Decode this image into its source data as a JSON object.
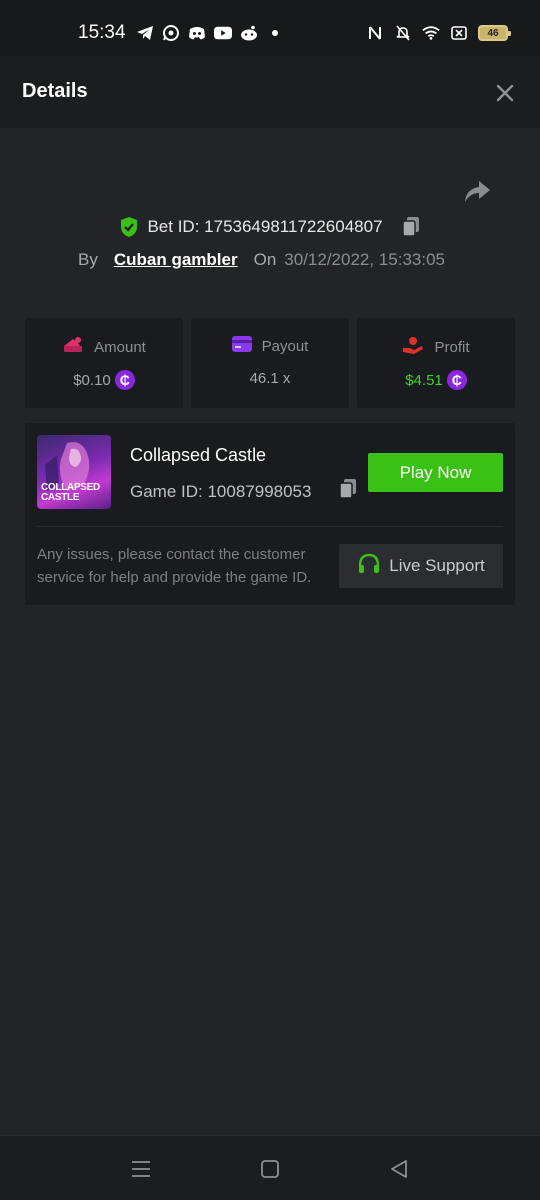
{
  "status_bar": {
    "time": "15:34",
    "left_icons": [
      "telegram-icon",
      "whatsapp-icon",
      "discord-icon",
      "youtube-icon",
      "reddit-icon",
      "dot-icon"
    ],
    "right_icons": [
      "nfc-icon",
      "mute-icon",
      "wifi-icon",
      "no-sim-icon"
    ],
    "battery": "46"
  },
  "header": {
    "title": "Details"
  },
  "bet": {
    "id_text": "Bet ID: 1753649811722604807",
    "by_label": "By",
    "user": "Cuban gambler",
    "on_label": "On",
    "date": "30/12/2022, 15:33:05"
  },
  "stats": {
    "amount": {
      "label": "Amount",
      "value": "$0.10"
    },
    "payout": {
      "label": "Payout",
      "value": "46.1 x"
    },
    "profit": {
      "label": "Profit",
      "value": "$4.51"
    },
    "coin_symbol": "₵"
  },
  "game": {
    "thumb_text_line1": "COLLAPSED",
    "thumb_text_line2": "CASTLE",
    "name": "Collapsed Castle",
    "game_id": "Game ID: 10087998053",
    "play_label": "Play Now",
    "issue_text": "Any issues, please contact the customer service for help and provide the game ID.",
    "live_support_label": "Live Support"
  },
  "colors": {
    "accent_green": "#3bc016",
    "profit_green": "#3ed126",
    "coin_purple": "#8a26e0",
    "amount_pink": "#e0306a",
    "payout_purple": "#8a3ae8",
    "profit_red": "#e0302a"
  }
}
